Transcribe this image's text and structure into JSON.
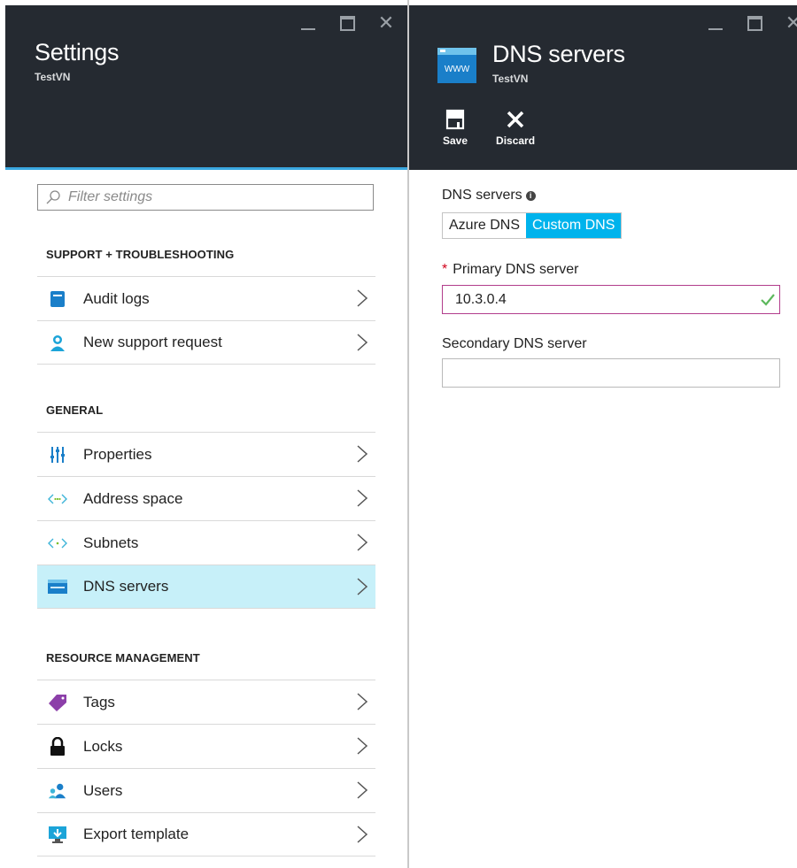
{
  "left_blade": {
    "title": "Settings",
    "subtitle": "TestVN",
    "filter_placeholder": "Filter settings",
    "sections": {
      "support": {
        "heading": "SUPPORT + TROUBLESHOOTING",
        "items": [
          "Audit logs",
          "New support request"
        ]
      },
      "general": {
        "heading": "GENERAL",
        "items": [
          "Properties",
          "Address space",
          "Subnets",
          "DNS servers"
        ],
        "selected": "DNS servers"
      },
      "resource": {
        "heading": "RESOURCE MANAGEMENT",
        "items": [
          "Tags",
          "Locks",
          "Users",
          "Export template"
        ]
      }
    }
  },
  "right_blade": {
    "title": "DNS servers",
    "subtitle": "TestVN",
    "icon_text": "WWW",
    "commands": {
      "save_label": "Save",
      "discard_label": "Discard"
    },
    "form": {
      "dns_servers_label": "DNS servers",
      "info_glyph": "i",
      "options": [
        "Azure DNS",
        "Custom DNS"
      ],
      "selected_option": "Custom DNS",
      "required_mark": "*",
      "primary_label": "Primary DNS server",
      "primary_value": "10.3.0.4",
      "secondary_label": "Secondary DNS server",
      "secondary_value": ""
    }
  },
  "colors": {
    "header_bg": "#252a31",
    "accent_blue": "#00b3ec",
    "selected_row": "#c7f0f9",
    "valid_border": "#b23d8c",
    "valid_check": "#5cb85c",
    "required_star": "#d0021b"
  },
  "icons": {
    "audit_logs": "audit-log-icon",
    "support": "support-person-icon",
    "properties": "properties-sliders-icon",
    "address_space": "address-space-icon",
    "subnets": "subnets-icon",
    "dns": "dns-server-icon",
    "tags": "tag-icon",
    "locks": "lock-icon",
    "users": "users-icon",
    "export": "export-template-icon"
  }
}
